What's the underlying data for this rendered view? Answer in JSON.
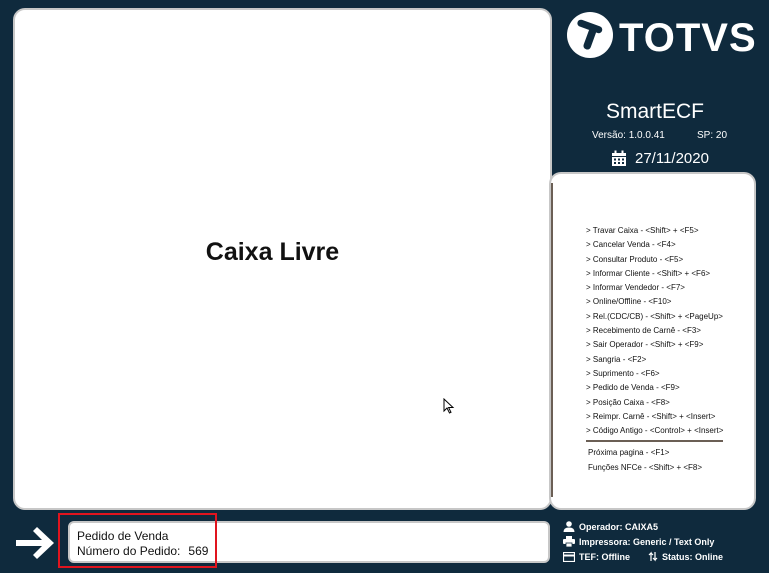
{
  "main": {
    "status_title": "Caixa Livre"
  },
  "brand": {
    "logo_text": "TOTVS",
    "app_name": "SmartECF",
    "version": "Versão: 1.0.0.41",
    "sp": "SP: 20",
    "date": "27/11/2020"
  },
  "shortcuts": [
    "> Travar Caixa - <Shift> + <F5>",
    "> Cancelar Venda - <F4>",
    "> Consultar Produto - <F5>",
    "> Informar Cliente - <Shift> + <F6>",
    "> Informar Vendedor - <F7>",
    "> Online/Offline - <F10>",
    "> Rel.(CDC/CB) - <Shift> + <PageUp>",
    "> Recebimento de Carnê - <F3>",
    "> Sair Operador - <Shift> + <F9>",
    "> Sangria - <F2>",
    "> Suprimento - <F6>",
    "> Pedido de Venda - <F9>",
    "> Posição Caixa - <F8>",
    "> Reimpr. Carnê - <Shift> + <Insert>",
    "> Código Antigo - <Control> + <Insert>"
  ],
  "shortcuts_extra": [
    "Próxima pagina - <F1>",
    "Funções NFCe - <Shift> + <F8>"
  ],
  "message": {
    "line1": "Pedido de Venda",
    "line2_label": "Número do Pedido:",
    "line2_value": "569"
  },
  "status": {
    "operador": "Operador: CAIXA5",
    "impressora": "Impressora: Generic / Text Only",
    "tef": "TEF: Offline",
    "status": "Status: Online"
  },
  "colors": {
    "background": "#0f2a3d",
    "highlight": "#e0141e"
  }
}
